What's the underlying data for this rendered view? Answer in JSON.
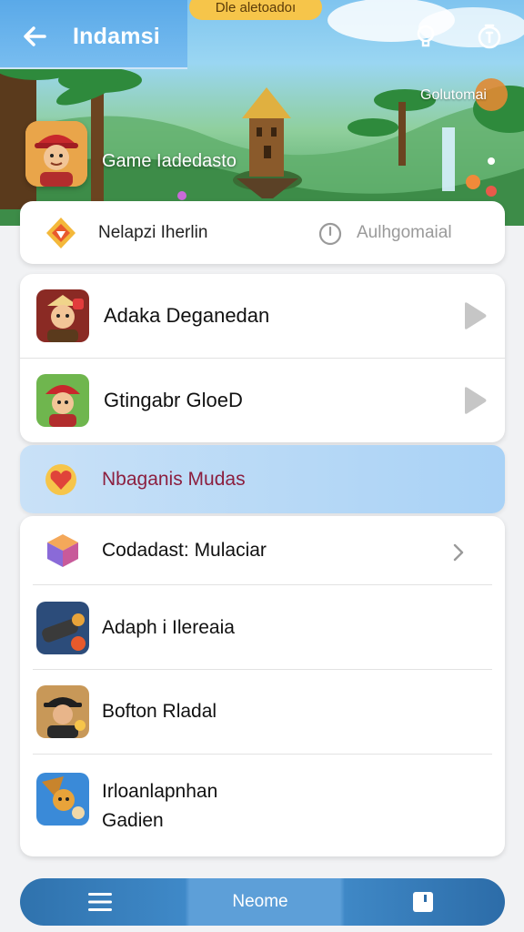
{
  "top_pill": "Dle aletoadoı",
  "header": {
    "title": "Indamsi",
    "back_icon": "arrow-left-icon",
    "right_icons": [
      "lightbulb-icon",
      "timer-icon"
    ]
  },
  "hero": {
    "badge": "Golutomai",
    "avatar_icon": "pirate-avatar-icon",
    "name": "Game Iadedasto"
  },
  "status": {
    "left": "Nelapzi Iherlin",
    "right": "Aulhgomaial"
  },
  "games": [
    {
      "label": "Adaka Deganedan",
      "icon": "warrior-portrait-icon"
    },
    {
      "label": "Gtingabr GloeD",
      "icon": "pirate-portrait-icon"
    }
  ],
  "highlight": {
    "label": "Nbaganis Mudas",
    "icon": "heart-shield-icon"
  },
  "list": [
    {
      "label": "Codadast: Mulaciar",
      "icon": "gem-cube-icon"
    },
    {
      "label": "Adaph i Ilereaia",
      "icon": "cannon-icon"
    },
    {
      "label": "Bofton Rladal",
      "icon": "hat-man-icon"
    },
    {
      "label": "Irloanlapnhan Gadien",
      "label_line1": "Irloanlapnhan",
      "label_line2": "Gadien",
      "icon": "adventurer-icon"
    }
  ],
  "bottom_nav": {
    "home_label": "Neome",
    "left_icon": "menu-icon",
    "right_icon": "window-icon"
  },
  "colors": {
    "accent": "#2f72ad",
    "highlight_text": "#8c1f3f",
    "pill": "#f6c54a"
  }
}
